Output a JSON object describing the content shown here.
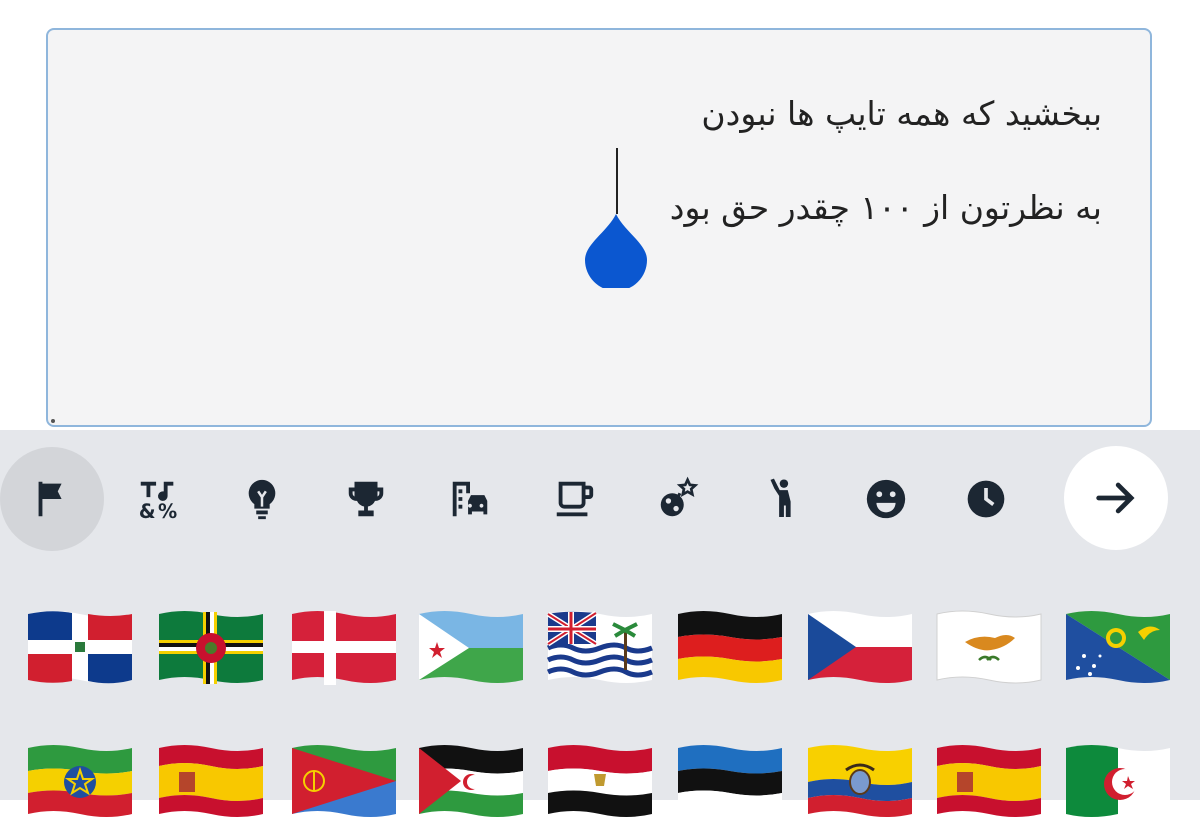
{
  "editor": {
    "line1": "ببخشید که همه تایپ ها نبودن",
    "line2": "به نظرتون از ۱۰۰ چقدر حق بود"
  },
  "colors": {
    "accent": "#0b57d0",
    "keyboard_bg": "#e5e7eb",
    "icon": "#1c2733"
  },
  "emoji_tabs": [
    {
      "icon": "flag-icon",
      "active": true
    },
    {
      "icon": "symbols-icon"
    },
    {
      "icon": "lightbulb-icon"
    },
    {
      "icon": "trophy-icon"
    },
    {
      "icon": "travel-icon"
    },
    {
      "icon": "food-icon"
    },
    {
      "icon": "nature-icon"
    },
    {
      "icon": "people-icon"
    },
    {
      "icon": "smiley-icon"
    },
    {
      "icon": "recent-icon"
    }
  ],
  "next_icon": "arrow-right-icon",
  "flags_row1": [
    "dominican-republic",
    "dominica",
    "denmark",
    "djibouti",
    "british-indian-ocean-territory",
    "germany",
    "czechia",
    "cyprus",
    "christmas-island"
  ],
  "flags_row2": [
    "ethiopia",
    "spain",
    "eritrea",
    "western-sahara",
    "egypt",
    "estonia",
    "ecuador",
    "ceuta-melilla",
    "algeria"
  ]
}
